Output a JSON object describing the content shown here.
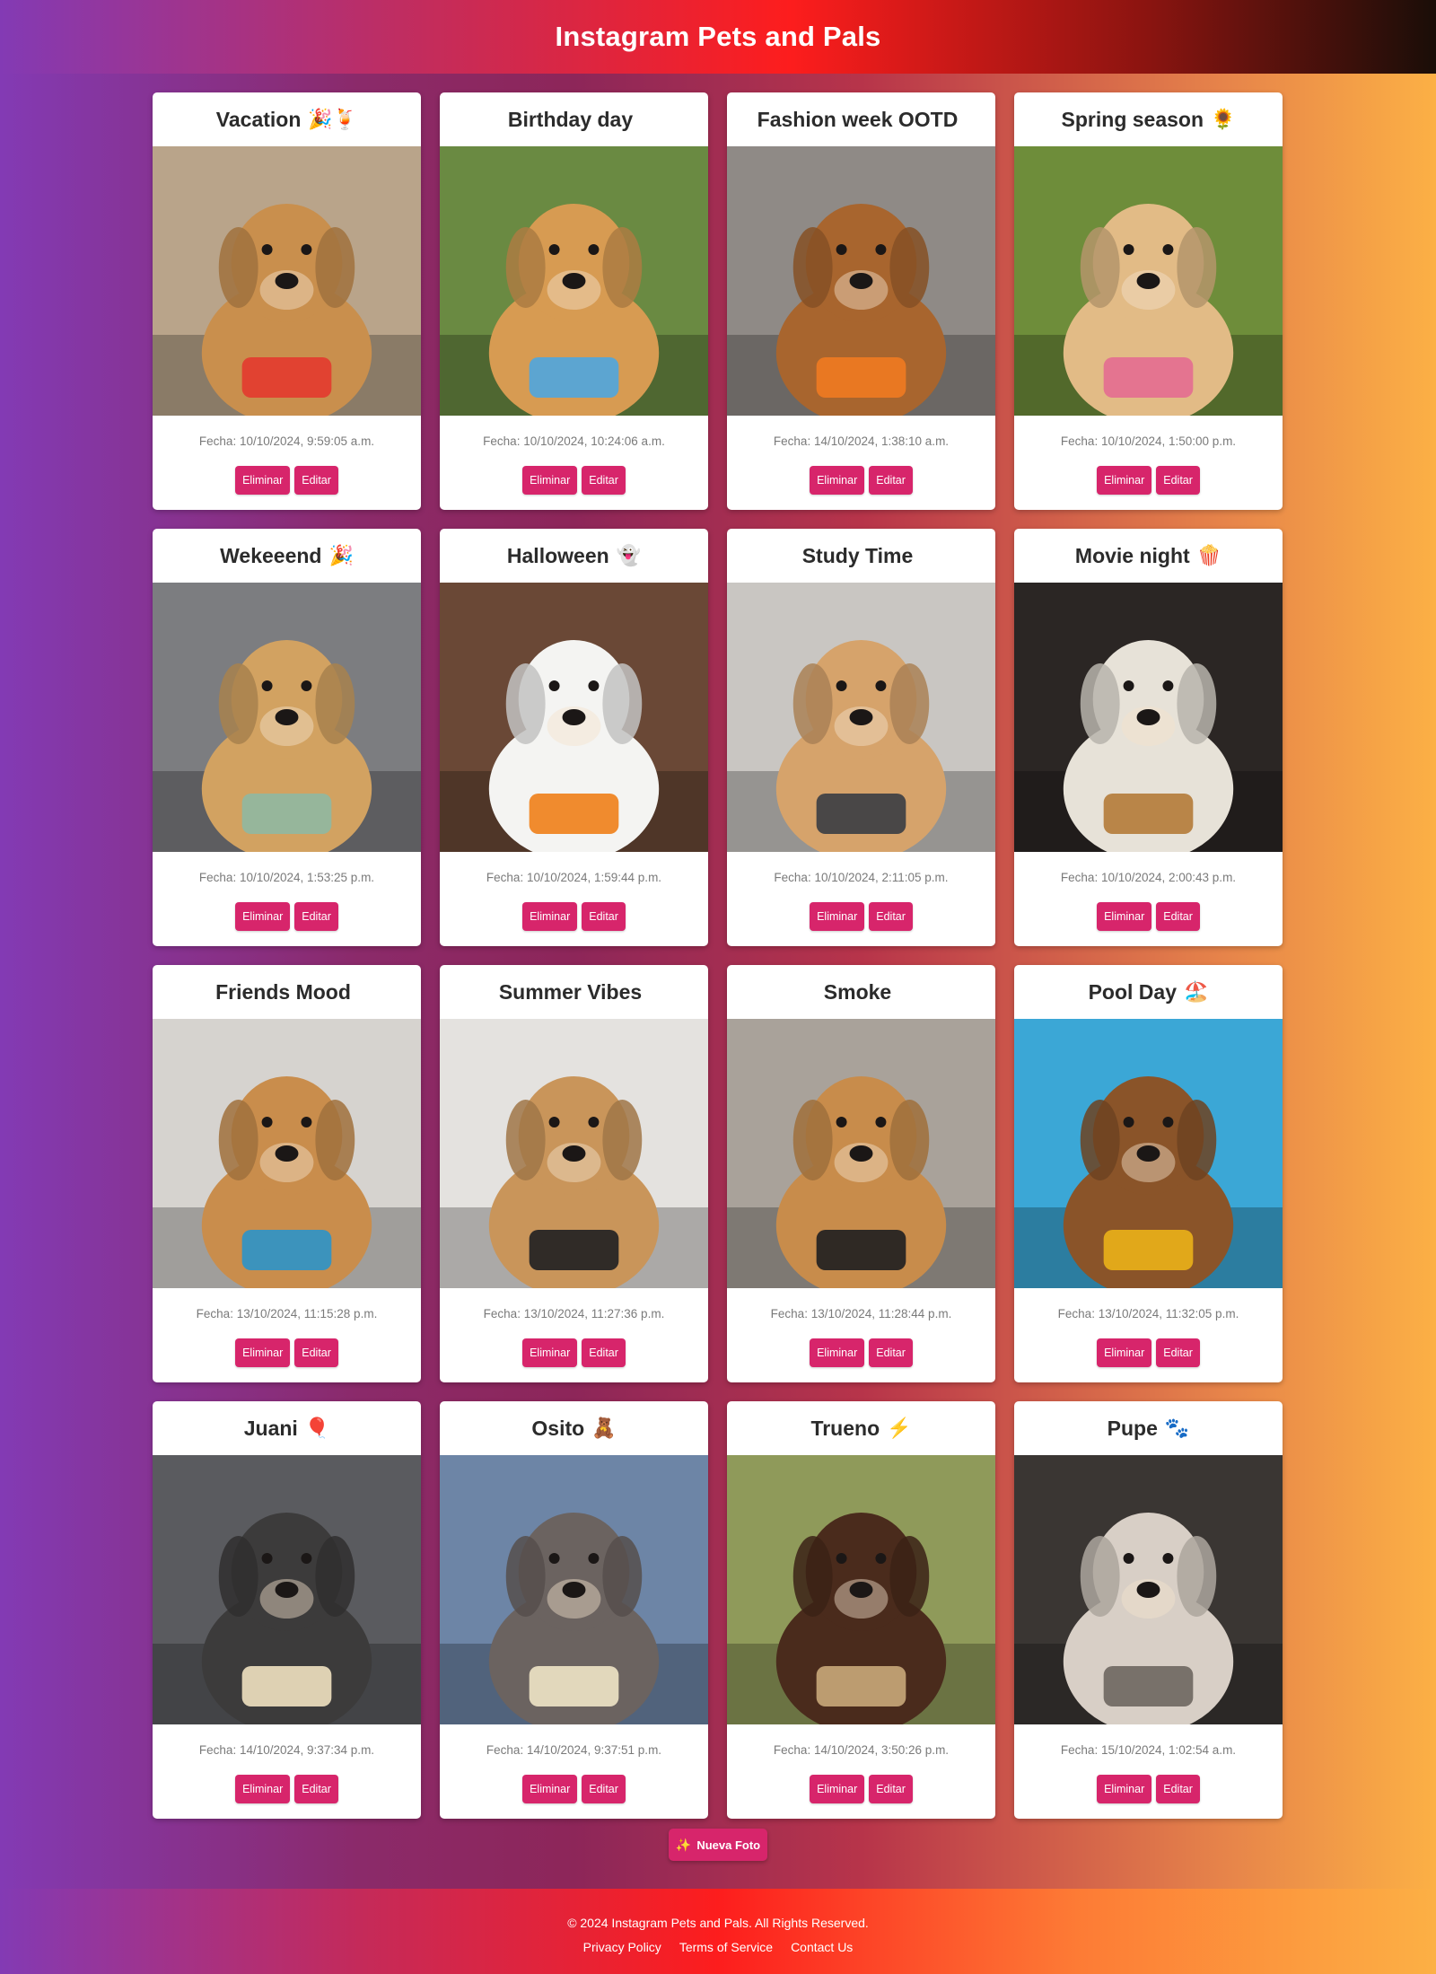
{
  "header": {
    "title": "Instagram Pets and Pals"
  },
  "cards": [
    {
      "title": "Vacation",
      "emoji": "🎉🍹",
      "date": "Fecha: 10/10/2024, 9:59:05 a.m.",
      "bg": "#b9a48a",
      "fg": "#c98f4d",
      "accent": "#e33a2f"
    },
    {
      "title": "Birthday day",
      "emoji": "",
      "date": "Fecha: 10/10/2024, 10:24:06 a.m.",
      "bg": "#6a8a42",
      "fg": "#d79b52",
      "accent": "#4fa6df"
    },
    {
      "title": "Fashion week OOTD",
      "emoji": "",
      "date": "Fecha: 14/10/2024, 1:38:10 a.m.",
      "bg": "#8f8a86",
      "fg": "#a8652e",
      "accent": "#ef7a21"
    },
    {
      "title": "Spring season",
      "emoji": "🌻",
      "date": "Fecha: 10/10/2024, 1:50:00 p.m.",
      "bg": "#6e8d3a",
      "fg": "#e2bb86",
      "accent": "#e46d91"
    },
    {
      "title": "Wekeeend",
      "emoji": "🎉",
      "date": "Fecha: 10/10/2024, 1:53:25 p.m.",
      "bg": "#7c7d80",
      "fg": "#d2a261",
      "accent": "#8fb8a2"
    },
    {
      "title": "Halloween",
      "emoji": "👻",
      "date": "Fecha: 10/10/2024, 1:59:44 p.m.",
      "bg": "#6a4836",
      "fg": "#f4f4f2",
      "accent": "#f07f18"
    },
    {
      "title": "Study Time",
      "emoji": "",
      "date": "Fecha: 10/10/2024, 2:11:05 p.m.",
      "bg": "#c9c6c2",
      "fg": "#d6a36b",
      "accent": "#3a3d44"
    },
    {
      "title": "Movie night",
      "emoji": "🍿",
      "date": "Fecha: 10/10/2024, 2:00:43 p.m.",
      "bg": "#2b2624",
      "fg": "#e7e2d8",
      "accent": "#b47b39"
    },
    {
      "title": "Friends Mood",
      "emoji": "",
      "date": "Fecha: 13/10/2024, 11:15:28 p.m.",
      "bg": "#d6d3cf",
      "fg": "#c98d4c",
      "accent": "#2c93c9"
    },
    {
      "title": "Summer Vibes",
      "emoji": "",
      "date": "Fecha: 13/10/2024, 11:27:36 p.m.",
      "bg": "#e4e2df",
      "fg": "#c9955a",
      "accent": "#1f1f21"
    },
    {
      "title": "Smoke",
      "emoji": "",
      "date": "Fecha: 13/10/2024, 11:28:44 p.m.",
      "bg": "#a9a29a",
      "fg": "#c88c4b",
      "accent": "#1e1e20"
    },
    {
      "title": "Pool Day",
      "emoji": "🏖️",
      "date": "Fecha: 13/10/2024, 11:32:05 p.m.",
      "bg": "#3ba7d6",
      "fg": "#8a5429",
      "accent": "#eab118"
    },
    {
      "title": "Juani",
      "emoji": "🎈",
      "date": "Fecha: 14/10/2024, 9:37:34 p.m.",
      "bg": "#5a5b5f",
      "fg": "#3c3b3b",
      "accent": "#f0e2c1"
    },
    {
      "title": "Osito",
      "emoji": "🧸",
      "date": "Fecha: 14/10/2024, 9:37:51 p.m.",
      "bg": "#6d85a6",
      "fg": "#6b6360",
      "accent": "#efe4c7"
    },
    {
      "title": "Trueno",
      "emoji": "⚡",
      "date": "Fecha: 14/10/2024, 3:50:26 p.m.",
      "bg": "#8f9a5a",
      "fg": "#4a2b1c",
      "accent": "#c9a87a"
    },
    {
      "title": "Pupe",
      "emoji": "🐾",
      "date": "Fecha: 15/10/2024, 1:02:54 a.m.",
      "bg": "#3a3633",
      "fg": "#d8cfc6",
      "accent": "#6e665f"
    }
  ],
  "buttons": {
    "delete_label": "Eliminar",
    "edit_label": "Editar"
  },
  "new_photo": {
    "icon": "✨",
    "label": "Nueva Foto"
  },
  "footer": {
    "copyright": "© 2024 Instagram Pets and Pals. All Rights Reserved.",
    "links": [
      "Privacy Policy",
      "Terms of Service",
      "Contact Us"
    ]
  }
}
